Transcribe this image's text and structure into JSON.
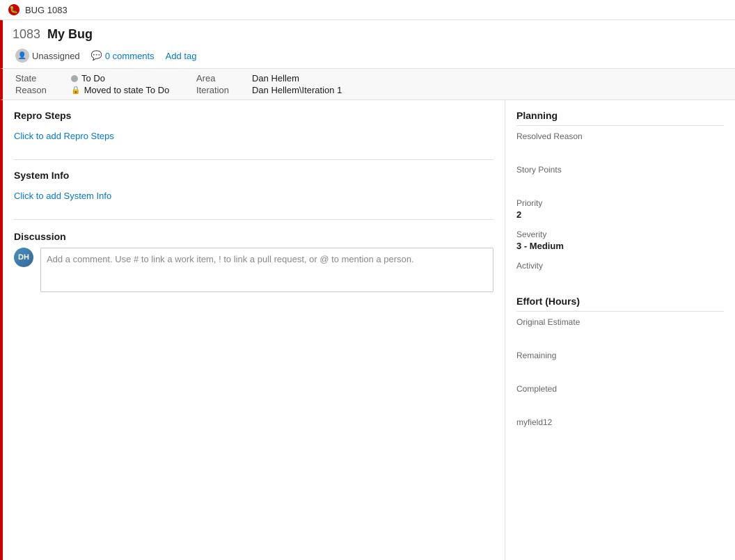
{
  "topBar": {
    "bugIcon": "🐛",
    "title": "BUG 1083"
  },
  "workItem": {
    "id": "1083",
    "title": "My Bug",
    "assignedTo": "Unassigned",
    "commentsCount": "0 comments",
    "addTagLabel": "Add tag"
  },
  "fields": {
    "stateLabel": "State",
    "stateValue": "To Do",
    "reasonLabel": "Reason",
    "reasonValue": "Moved to state To Do",
    "areaLabel": "Area",
    "areaValue": "Dan Hellem",
    "iterationLabel": "Iteration",
    "iterationValue": "Dan Hellem\\Iteration 1"
  },
  "sections": {
    "reproStepsTitle": "Repro Steps",
    "reproStepsPlaceholder": "Click to add Repro Steps",
    "systemInfoTitle": "System Info",
    "systemInfoPlaceholder": "Click to add System Info",
    "discussionTitle": "Discussion",
    "commentPlaceholder": "Add a comment. Use # to link a work item, ! to link a pull request, or @ to mention a person."
  },
  "planning": {
    "title": "Planning",
    "resolvedReasonLabel": "Resolved Reason",
    "resolvedReasonValue": "",
    "storyPointsLabel": "Story Points",
    "storyPointsValue": "",
    "priorityLabel": "Priority",
    "priorityValue": "2",
    "severityLabel": "Severity",
    "severityValue": "3 - Medium",
    "activityLabel": "Activity",
    "activityValue": ""
  },
  "effort": {
    "title": "Effort (Hours)",
    "originalEstimateLabel": "Original Estimate",
    "originalEstimateValue": "",
    "remainingLabel": "Remaining",
    "remainingValue": "",
    "completedLabel": "Completed",
    "completedValue": "",
    "myfield12Label": "myfield12",
    "myfield12Value": ""
  },
  "colors": {
    "accent": "#cc0000",
    "link": "#0078d4"
  }
}
